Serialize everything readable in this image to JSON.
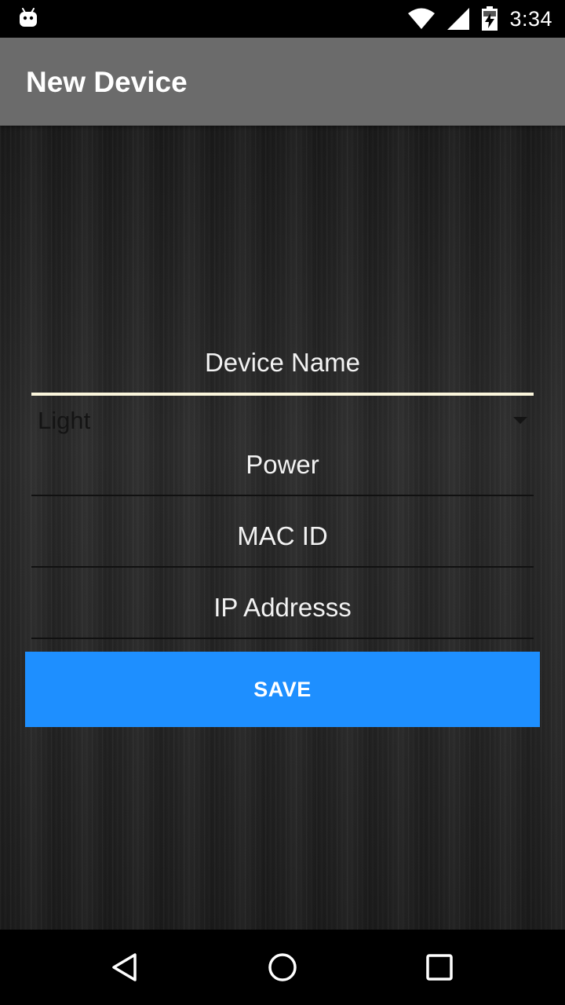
{
  "status_bar": {
    "time": "3:34",
    "icons": [
      "android-icon",
      "wifi-icon",
      "cell-signal-icon",
      "battery-charging-icon"
    ]
  },
  "app_bar": {
    "title": "New Device",
    "color": "#6b6b6b"
  },
  "form": {
    "device_name": "Device Name",
    "device_type": {
      "selected": "Light"
    },
    "power": "Power",
    "mac_id": "MAC ID",
    "ip_address": "IP Addresss",
    "save_label": "SAVE"
  },
  "colors": {
    "accent": "#1e8fff",
    "active_underline": "#fbf6dc"
  },
  "nav_bar": {
    "icons": [
      "back-icon",
      "home-icon",
      "recents-icon"
    ]
  }
}
